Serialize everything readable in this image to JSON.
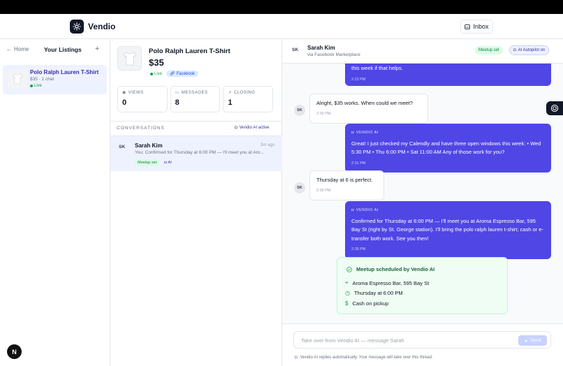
{
  "app": {
    "name": "Vendio",
    "inbox_label": "Inbox"
  },
  "sidebar": {
    "home_label": "Home",
    "title": "Your Listings",
    "add_label": "+",
    "listings": [
      {
        "title": "Polo Ralph Lauren T-Shirt",
        "subtitle": "$35 · 1 chat",
        "status": "Live"
      }
    ],
    "user_initial": "N"
  },
  "product": {
    "title": "Polo Ralph Lauren T-Shirt",
    "price": "$35",
    "status": "Live",
    "platform": "Facebook",
    "stats": [
      {
        "label": "VIEWS",
        "value": "0",
        "icon": "eye-icon"
      },
      {
        "label": "MESSAGES",
        "value": "8",
        "icon": "message-icon"
      },
      {
        "label": "CLOSING",
        "value": "1",
        "icon": "trend-up-icon"
      }
    ]
  },
  "conversations": {
    "title": "CONVERSATIONS",
    "ai_status": "Vendio AI active",
    "items": [
      {
        "initials": "SK",
        "name": "Sarah Kim",
        "time": "3m ago",
        "preview": "You: Confirmed for Thursday at 6:00 PM — I'll meet you at Aro...",
        "tag_meetup": "Meetup set",
        "tag_ai": "AI"
      }
    ]
  },
  "chat": {
    "initials": "SK",
    "name": "Sarah Kim",
    "source": "via Facebook Marketplace",
    "meetup_badge": "Meetup set",
    "autopilot_badge": "AI Autopilot on",
    "messages": [
      {
        "from": "ai",
        "text": "this week if that helps.",
        "time": "2:23 PM"
      },
      {
        "from": "buyer",
        "text": "Alright, $35 works. When could we meet?",
        "time": "2:30 PM"
      },
      {
        "from": "ai",
        "label": "VENDIO AI",
        "text": "Great! I just checked my Calendly and have three open windows this week: • Wed 5:30 PM • Thu 6:00 PM • Sat 11:00 AM Any of those work for you?",
        "time": "2:31 PM"
      },
      {
        "from": "buyer",
        "text": "Thursday at 6 is perfect.",
        "time": "2:38 PM"
      },
      {
        "from": "ai",
        "label": "VENDIO AI",
        "text": "Confirmed for Thursday at 6:00 PM — I'll meet you at Aroma Espresso Bar, 595 Bay St (right by St. George station). I'll bring the polo ralph lauren t-shirt; cash or e-transfer both work. See you then!",
        "time": "2:39 PM"
      }
    ],
    "meetup": {
      "title": "Meetup scheduled by Vendio AI",
      "location": "Aroma Espresso Bar, 595 Bay St",
      "time": "Thursday at 6:00 PM",
      "payment": "Cash on pickup"
    },
    "compose": {
      "placeholder": "Take over from Vendio AI — message Sarah",
      "send_label": "Send",
      "note": "Vendio AI replies automatically. Your message will take over this thread."
    }
  },
  "colors": {
    "accent": "#4f46e5",
    "success": "#16a34a",
    "facebook": "#1d4ed8"
  }
}
